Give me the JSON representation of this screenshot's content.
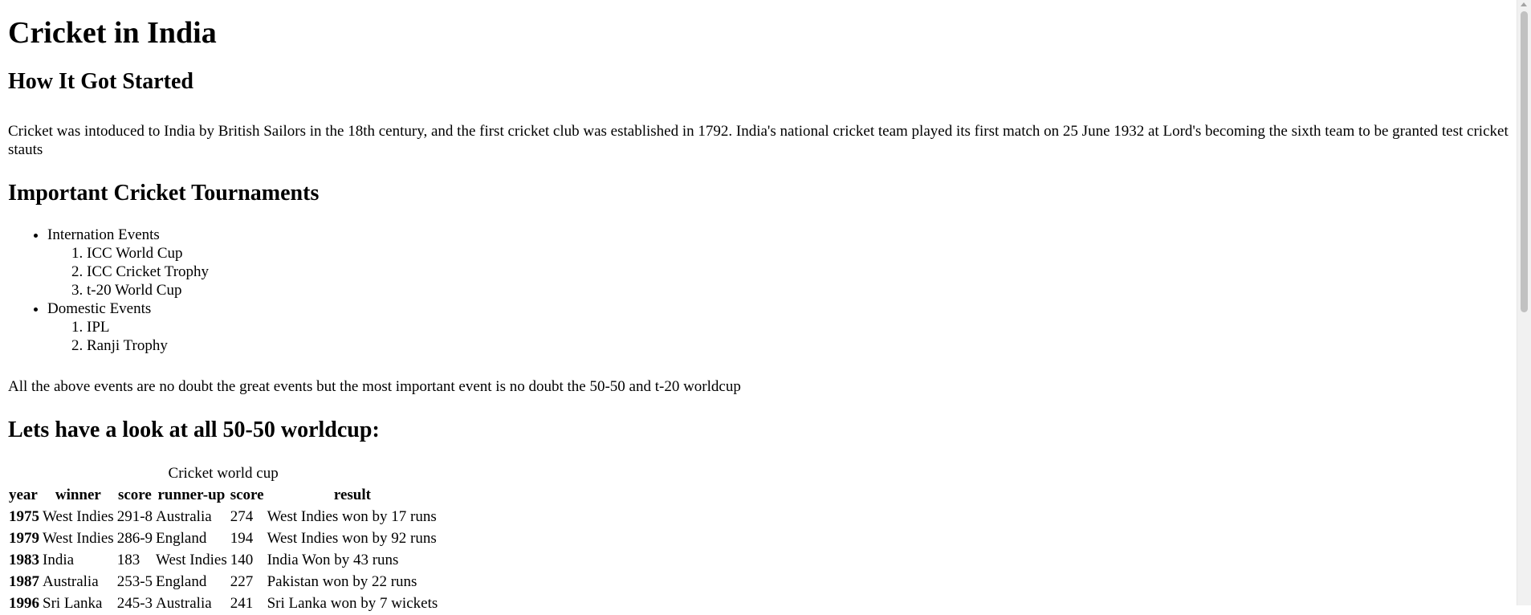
{
  "title": "Cricket in India",
  "section1": {
    "heading": "How It Got Started",
    "paragraph": "Cricket was intoduced to India by British Sailors in the 18th century, and the first cricket club was established in 1792. India's national cricket team played its first match on 25 June 1932 at Lord's becoming the sixth team to be granted test cricket stauts"
  },
  "section2": {
    "heading": "Important Cricket Tournaments",
    "groups": [
      {
        "label": "Internation Events",
        "items": [
          "ICC World Cup",
          "ICC Cricket Trophy",
          "t-20 World Cup"
        ]
      },
      {
        "label": "Domestic Events",
        "items": [
          "IPL",
          "Ranji Trophy"
        ]
      }
    ],
    "paragraph": "All the above events are no doubt the great events but the most important event is no doubt the 50-50 and t-20 worldcup"
  },
  "section3": {
    "heading": "Lets have a look at all 50-50 worldcup:",
    "table": {
      "caption": "Cricket world cup",
      "headers": [
        "year",
        "winner",
        "score",
        "runner-up",
        "score",
        "result"
      ],
      "rows": [
        [
          "1975",
          "West Indies",
          "291-8",
          "Australia",
          "274",
          "West Indies won by 17 runs"
        ],
        [
          "1979",
          "West Indies",
          "286-9",
          "England",
          "194",
          "West Indies won by 92 runs"
        ],
        [
          "1983",
          "India",
          "183",
          "West Indies",
          "140",
          "India Won by 43 runs"
        ],
        [
          "1987",
          "Australia",
          "253-5",
          "England",
          "227",
          "Pakistan won by 22 runs"
        ],
        [
          "1996",
          "Sri Lanka",
          "245-3",
          "Australia",
          "241",
          "Sri Lanka won by 7 wickets"
        ]
      ]
    }
  }
}
